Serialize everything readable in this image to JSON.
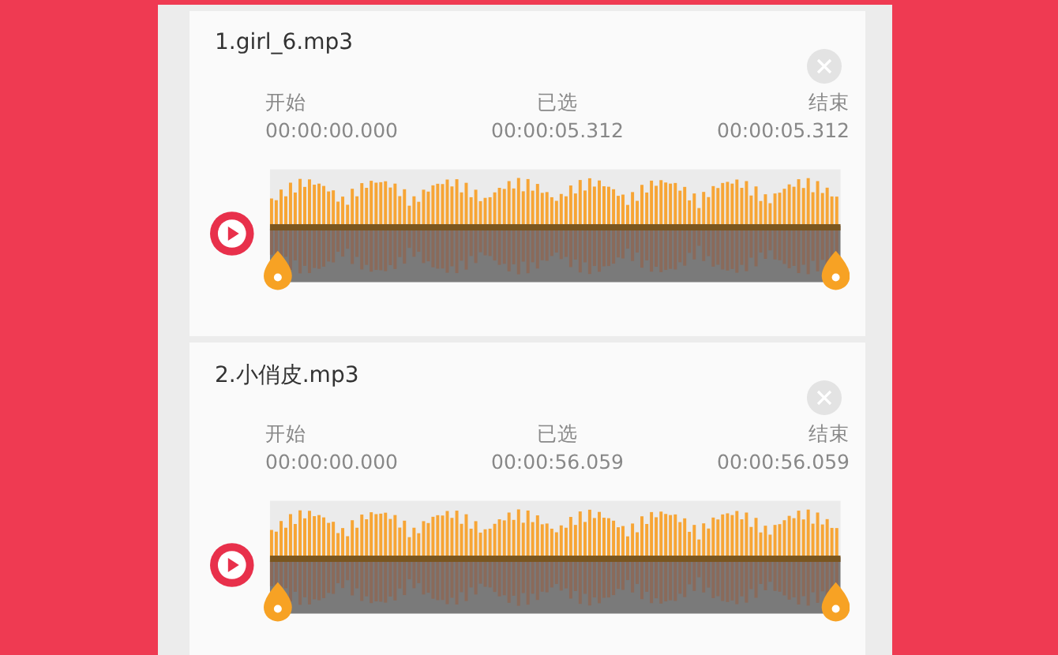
{
  "files": [
    {
      "title": "1.girl_6.mp3",
      "times": [
        {
          "label": "开始",
          "value": "00:00:00.000"
        },
        {
          "label": "已选",
          "value": "00:00:05.312"
        },
        {
          "label": "结束",
          "value": "00:00:05.312"
        }
      ]
    },
    {
      "title": "2.小俏皮.mp3",
      "times": [
        {
          "label": "开始",
          "value": "00:00:00.000"
        },
        {
          "label": "已选",
          "value": "00:00:56.059"
        },
        {
          "label": "结束",
          "value": "00:00:56.059"
        }
      ]
    }
  ]
}
